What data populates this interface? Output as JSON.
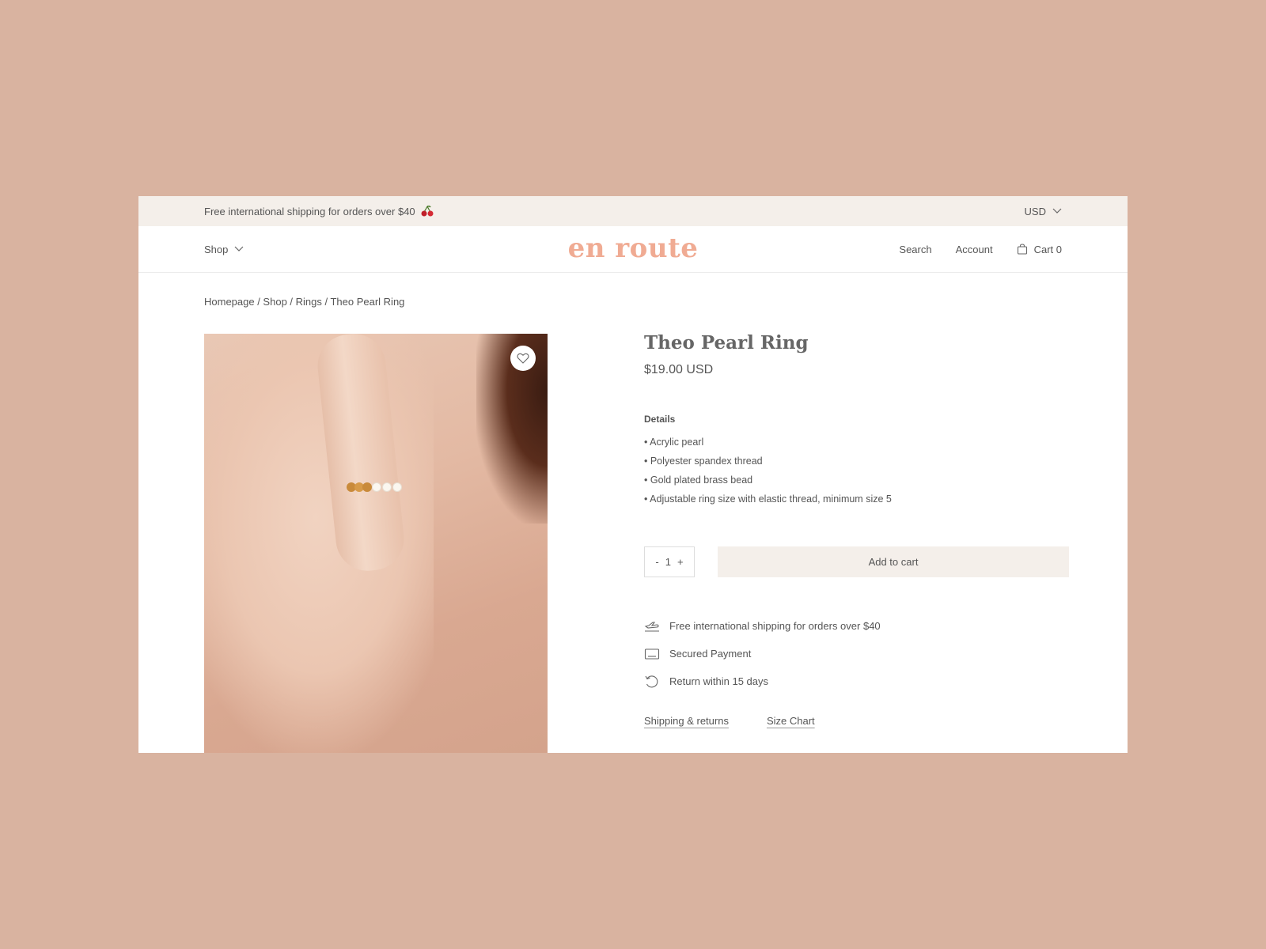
{
  "announcement": {
    "text": "Free international shipping for orders over $40",
    "emoji_icon": "cherry-icon",
    "currency": "USD"
  },
  "header": {
    "shop_label": "Shop",
    "logo": "en route",
    "search_label": "Search",
    "account_label": "Account",
    "cart_label": "Cart 0"
  },
  "breadcrumb": {
    "text": "Homepage / Shop / Rings / Theo Pearl Ring"
  },
  "product": {
    "title": "Theo Pearl Ring",
    "price": "$19.00 USD",
    "details_title": "Details",
    "details": [
      "• Acrylic pearl",
      "• Polyester spandex thread",
      "• Gold plated brass bead",
      "• Adjustable ring size with elastic thread, minimum size 5"
    ],
    "quantity": {
      "minus": "-",
      "value": "1",
      "plus": "+"
    },
    "add_to_cart_label": "Add to cart"
  },
  "features": [
    {
      "icon": "plane-icon",
      "text": "Free international shipping for orders over $40"
    },
    {
      "icon": "card-icon",
      "text": "Secured Payment"
    },
    {
      "icon": "return-icon",
      "text": "Return within 15 days"
    }
  ],
  "links": {
    "shipping_returns": "Shipping & returns",
    "size_chart": "Size Chart"
  },
  "colors": {
    "background": "#d9b3a0",
    "announcement_bg": "#f4efea",
    "logo": "#f0ab93",
    "button_bg": "#f4efea",
    "text": "#555555"
  }
}
